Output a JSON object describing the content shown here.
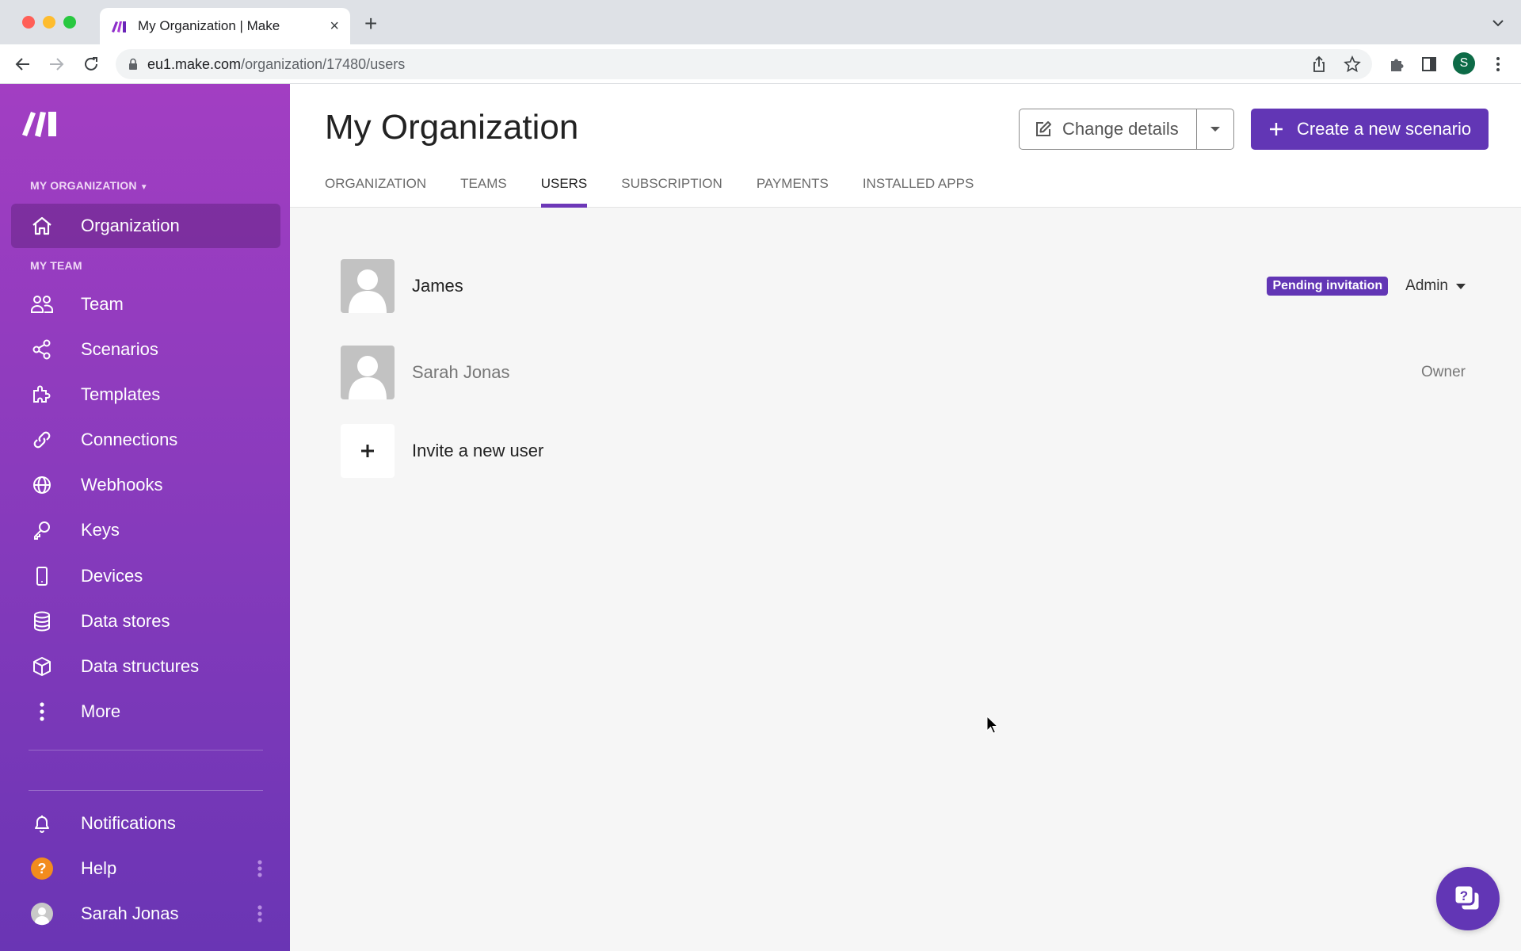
{
  "browser": {
    "tab_title": "My Organization | Make",
    "url_host": "eu1.make.com",
    "url_path": "/organization/17480/users",
    "profile_initial": "S"
  },
  "sidebar": {
    "org_label": "MY ORGANIZATION",
    "team_label": "MY TEAM",
    "org_item": {
      "label": "Organization",
      "icon": "home-icon"
    },
    "items": [
      {
        "label": "Team",
        "icon": "users-icon"
      },
      {
        "label": "Scenarios",
        "icon": "share-nodes-icon"
      },
      {
        "label": "Templates",
        "icon": "puzzle-icon"
      },
      {
        "label": "Connections",
        "icon": "link-icon"
      },
      {
        "label": "Webhooks",
        "icon": "globe-icon"
      },
      {
        "label": "Keys",
        "icon": "key-icon"
      },
      {
        "label": "Devices",
        "icon": "mobile-icon"
      },
      {
        "label": "Data stores",
        "icon": "database-icon"
      },
      {
        "label": "Data structures",
        "icon": "cube-icon"
      },
      {
        "label": "More",
        "icon": "more-vertical-icon"
      }
    ],
    "bottom": [
      {
        "label": "Notifications",
        "icon": "bell-icon"
      },
      {
        "label": "Help",
        "icon": "help-circle-icon"
      },
      {
        "label": "Sarah Jonas",
        "icon": "avatar-icon"
      }
    ]
  },
  "header": {
    "title": "My Organization",
    "change_details": "Change details",
    "create_scenario": "Create a new scenario",
    "tabs": [
      {
        "label": "ORGANIZATION",
        "active": false
      },
      {
        "label": "TEAMS",
        "active": false
      },
      {
        "label": "USERS",
        "active": true
      },
      {
        "label": "SUBSCRIPTION",
        "active": false
      },
      {
        "label": "PAYMENTS",
        "active": false
      },
      {
        "label": "INSTALLED APPS",
        "active": false
      }
    ]
  },
  "users": [
    {
      "name": "James",
      "badge": "Pending invitation",
      "role": "Admin",
      "role_editable": true
    },
    {
      "name": "Sarah Jonas",
      "badge": null,
      "role": "Owner",
      "role_editable": false
    }
  ],
  "invite": {
    "label": "Invite a new user"
  },
  "colors": {
    "accent": "#6236b5",
    "sidebar_top": "#a23ec2",
    "sidebar_bottom": "#6a35b4",
    "help_orange": "#f28c1e"
  }
}
